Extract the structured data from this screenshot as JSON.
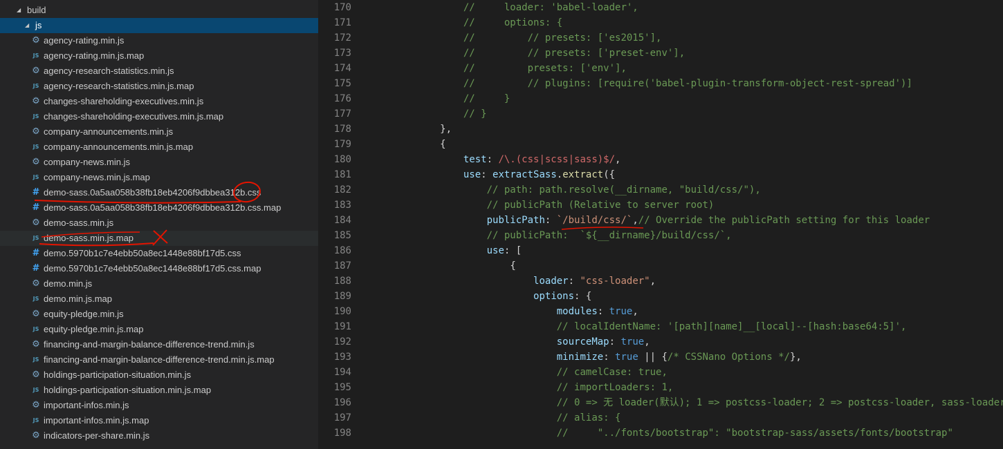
{
  "explorer": {
    "folder_build": "build",
    "folder_js": "js",
    "files": [
      {
        "name": "agency-rating.min.js",
        "icon": "gear-icon"
      },
      {
        "name": "agency-rating.min.js.map",
        "icon": "js-icon"
      },
      {
        "name": "agency-research-statistics.min.js",
        "icon": "gear-icon"
      },
      {
        "name": "agency-research-statistics.min.js.map",
        "icon": "js-icon"
      },
      {
        "name": "changes-shareholding-executives.min.js",
        "icon": "gear-icon"
      },
      {
        "name": "changes-shareholding-executives.min.js.map",
        "icon": "js-icon"
      },
      {
        "name": "company-announcements.min.js",
        "icon": "gear-icon"
      },
      {
        "name": "company-announcements.min.js.map",
        "icon": "js-icon"
      },
      {
        "name": "company-news.min.js",
        "icon": "gear-icon"
      },
      {
        "name": "company-news.min.js.map",
        "icon": "js-icon"
      },
      {
        "name": "demo-sass.0a5aa058b38fb18eb4206f9dbbea312b.css",
        "icon": "hash-icon"
      },
      {
        "name": "demo-sass.0a5aa058b38fb18eb4206f9dbbea312b.css.map",
        "icon": "hash-icon"
      },
      {
        "name": "demo-sass.min.js",
        "icon": "gear-icon"
      },
      {
        "name": "demo-sass.min.js.map",
        "icon": "js-icon"
      },
      {
        "name": "demo.5970b1c7e4ebb50a8ec1448e88bf17d5.css",
        "icon": "hash-icon"
      },
      {
        "name": "demo.5970b1c7e4ebb50a8ec1448e88bf17d5.css.map",
        "icon": "hash-icon"
      },
      {
        "name": "demo.min.js",
        "icon": "gear-icon"
      },
      {
        "name": "demo.min.js.map",
        "icon": "js-icon"
      },
      {
        "name": "equity-pledge.min.js",
        "icon": "gear-icon"
      },
      {
        "name": "equity-pledge.min.js.map",
        "icon": "js-icon"
      },
      {
        "name": "financing-and-margin-balance-difference-trend.min.js",
        "icon": "gear-icon"
      },
      {
        "name": "financing-and-margin-balance-difference-trend.min.js.map",
        "icon": "js-icon"
      },
      {
        "name": "holdings-participation-situation.min.js",
        "icon": "gear-icon"
      },
      {
        "name": "holdings-participation-situation.min.js.map",
        "icon": "js-icon"
      },
      {
        "name": "important-infos.min.js",
        "icon": "gear-icon"
      },
      {
        "name": "important-infos.min.js.map",
        "icon": "js-icon"
      },
      {
        "name": "indicators-per-share.min.js",
        "icon": "gear-icon"
      }
    ]
  },
  "editor": {
    "lines": [
      {
        "n": "170",
        "indent": 4,
        "t": [
          [
            "c",
            "//     loader: 'babel-loader',"
          ]
        ]
      },
      {
        "n": "171",
        "indent": 4,
        "t": [
          [
            "c",
            "//     options: {"
          ]
        ]
      },
      {
        "n": "172",
        "indent": 4,
        "t": [
          [
            "c",
            "//         // presets: ['es2015'],"
          ]
        ]
      },
      {
        "n": "173",
        "indent": 4,
        "t": [
          [
            "c",
            "//         // presets: ['preset-env'],"
          ]
        ]
      },
      {
        "n": "174",
        "indent": 4,
        "t": [
          [
            "c",
            "//         presets: ['env'],"
          ]
        ]
      },
      {
        "n": "175",
        "indent": 4,
        "t": [
          [
            "c",
            "//         // plugins: [require('babel-plugin-transform-object-rest-spread')]"
          ]
        ]
      },
      {
        "n": "176",
        "indent": 4,
        "t": [
          [
            "c",
            "//     }"
          ]
        ]
      },
      {
        "n": "177",
        "indent": 4,
        "t": [
          [
            "c",
            "// }"
          ]
        ]
      },
      {
        "n": "178",
        "indent": 3,
        "t": [
          [
            "p",
            "},"
          ]
        ]
      },
      {
        "n": "179",
        "indent": 3,
        "t": [
          [
            "p",
            "{"
          ]
        ]
      },
      {
        "n": "180",
        "indent": 4,
        "t": [
          [
            "k",
            "test"
          ],
          [
            "p",
            ": "
          ],
          [
            "r",
            "/\\.(css|scss|sass)$/"
          ],
          [
            "p",
            ","
          ]
        ]
      },
      {
        "n": "181",
        "indent": 4,
        "t": [
          [
            "k",
            "use"
          ],
          [
            "p",
            ": "
          ],
          [
            "k",
            "extractSass"
          ],
          [
            "p",
            "."
          ],
          [
            "f",
            "extract"
          ],
          [
            "p",
            "({"
          ]
        ]
      },
      {
        "n": "182",
        "indent": 5,
        "t": [
          [
            "c",
            "// path: path.resolve(__dirname, \"build/css/\"),"
          ]
        ]
      },
      {
        "n": "183",
        "indent": 5,
        "t": [
          [
            "c",
            "// publicPath (Relative to server root)"
          ]
        ]
      },
      {
        "n": "184",
        "indent": 5,
        "t": [
          [
            "k",
            "publicPath"
          ],
          [
            "p",
            ": "
          ],
          [
            "s",
            "`/build/css/`"
          ],
          [
            "p",
            ","
          ],
          [
            "c",
            "// Override the publicPath setting for this loader"
          ]
        ]
      },
      {
        "n": "185",
        "indent": 5,
        "t": [
          [
            "c",
            "// publicPath:  `${__dirname}/build/css/`,"
          ]
        ]
      },
      {
        "n": "186",
        "indent": 5,
        "t": [
          [
            "k",
            "use"
          ],
          [
            "p",
            ": ["
          ]
        ]
      },
      {
        "n": "187",
        "indent": 6,
        "t": [
          [
            "p",
            "{"
          ]
        ]
      },
      {
        "n": "188",
        "indent": 7,
        "t": [
          [
            "k",
            "loader"
          ],
          [
            "p",
            ": "
          ],
          [
            "s",
            "\"css-loader\""
          ],
          [
            "p",
            ","
          ]
        ]
      },
      {
        "n": "189",
        "indent": 7,
        "t": [
          [
            "k",
            "options"
          ],
          [
            "p",
            ": {"
          ]
        ]
      },
      {
        "n": "190",
        "indent": 8,
        "t": [
          [
            "k",
            "modules"
          ],
          [
            "p",
            ": "
          ],
          [
            "w",
            "true"
          ],
          [
            "p",
            ","
          ]
        ]
      },
      {
        "n": "191",
        "indent": 8,
        "t": [
          [
            "c",
            "// localIdentName: '[path][name]__[local]--[hash:base64:5]',"
          ]
        ]
      },
      {
        "n": "192",
        "indent": 8,
        "t": [
          [
            "k",
            "sourceMap"
          ],
          [
            "p",
            ": "
          ],
          [
            "w",
            "true"
          ],
          [
            "p",
            ","
          ]
        ]
      },
      {
        "n": "193",
        "indent": 8,
        "t": [
          [
            "k",
            "minimize"
          ],
          [
            "p",
            ": "
          ],
          [
            "w",
            "true"
          ],
          [
            "p",
            " || {"
          ],
          [
            "c",
            "/* CSSNano Options */"
          ],
          [
            "p",
            "},"
          ]
        ]
      },
      {
        "n": "194",
        "indent": 8,
        "t": [
          [
            "c",
            "// camelCase: true,"
          ]
        ]
      },
      {
        "n": "195",
        "indent": 8,
        "t": [
          [
            "c",
            "// importLoaders: 1,"
          ]
        ]
      },
      {
        "n": "196",
        "indent": 8,
        "t": [
          [
            "c",
            "// 0 => 无 loader(默认); 1 => postcss-loader; 2 => postcss-loader, sass-loader"
          ]
        ]
      },
      {
        "n": "197",
        "indent": 8,
        "t": [
          [
            "c",
            "// alias: {"
          ]
        ]
      },
      {
        "n": "198",
        "indent": 8,
        "t": [
          [
            "c",
            "//     \"../fonts/bootstrap\": \"bootstrap-sass/assets/fonts/bootstrap\""
          ]
        ]
      }
    ]
  },
  "colors": {
    "sidebar_bg": "#252526",
    "selected_bg": "#094771",
    "editor_bg": "#1e1e1e",
    "annotation_red": "#e51400"
  }
}
